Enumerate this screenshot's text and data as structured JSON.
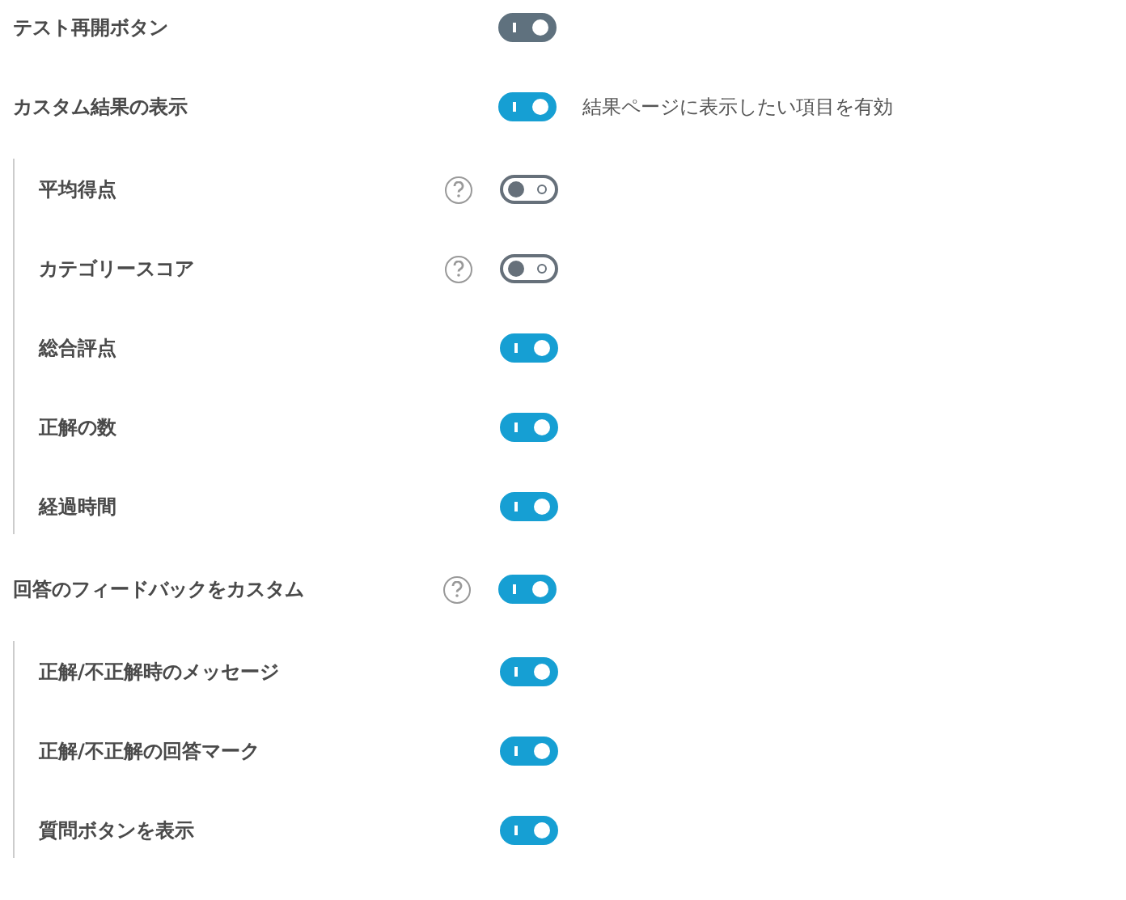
{
  "settings": [
    {
      "label": "テスト再開ボタン",
      "on": true,
      "disabled": true
    },
    {
      "label": "カスタム結果の表示",
      "on": true,
      "disabled": false,
      "description": "結果ページに表示したい項目を有効",
      "children": [
        {
          "label": "平均得点",
          "help": true,
          "on": false,
          "disabled": false
        },
        {
          "label": "カテゴリースコア",
          "help": true,
          "on": false,
          "disabled": false
        },
        {
          "label": "総合評点",
          "on": true,
          "disabled": false
        },
        {
          "label": "正解の数",
          "on": true,
          "disabled": false
        },
        {
          "label": "経過時間",
          "on": true,
          "disabled": false
        }
      ]
    },
    {
      "label": "回答のフィードバックをカスタム",
      "help": true,
      "on": true,
      "disabled": false,
      "children": [
        {
          "label": "正解/不正解時のメッセージ",
          "on": true,
          "disabled": false
        },
        {
          "label": "正解/不正解の回答マーク",
          "on": true,
          "disabled": false
        },
        {
          "label": "質問ボタンを表示",
          "on": true,
          "disabled": false
        }
      ]
    }
  ]
}
